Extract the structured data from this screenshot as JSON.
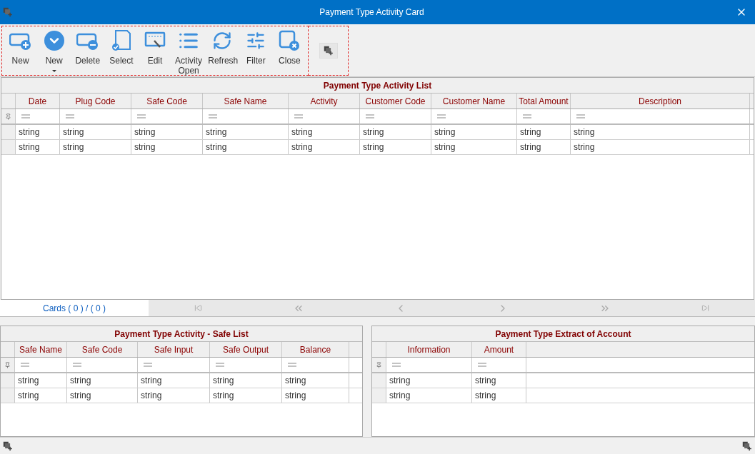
{
  "window": {
    "title": "Payment Type Activity Card"
  },
  "toolbar": {
    "buttons": [
      {
        "label": "New",
        "kind": "new"
      },
      {
        "label": "New",
        "kind": "dropdown"
      },
      {
        "label": "Delete",
        "kind": "delete"
      },
      {
        "label": "Select",
        "kind": "select"
      },
      {
        "label": "Edit",
        "kind": "edit"
      },
      {
        "label": "Activity Open",
        "kind": "list"
      },
      {
        "label": "Refresh",
        "kind": "refresh"
      },
      {
        "label": "Filter",
        "kind": "filter"
      },
      {
        "label": "Close",
        "kind": "close"
      }
    ]
  },
  "activity_list": {
    "title": "Payment Type Activity List",
    "columns": [
      "Date",
      "Plug Code",
      "Safe Code",
      "Safe Name",
      "Activity",
      "Customer Code",
      "Customer Name",
      "Total Amount",
      "Description"
    ],
    "rows": [
      [
        "string",
        "string",
        "string",
        "string",
        "string",
        "string",
        "string",
        "string",
        "string"
      ],
      [
        "string",
        "string",
        "string",
        "string",
        "string",
        "string",
        "string",
        "string",
        "string"
      ]
    ]
  },
  "pager": {
    "label": "Cards ( 0 ) / ( 0 )"
  },
  "safe_list": {
    "title": "Payment Type Activity - Safe List",
    "columns": [
      "Safe Name",
      "Safe Code",
      "Safe Input",
      "Safe Output",
      "Balance"
    ],
    "rows": [
      [
        "string",
        "string",
        "string",
        "string",
        "string"
      ],
      [
        "string",
        "string",
        "string",
        "string",
        "string"
      ]
    ]
  },
  "extract": {
    "title": "Payment Type Extract of Account",
    "columns": [
      "Information",
      "Amount"
    ],
    "rows": [
      [
        "string",
        "string"
      ],
      [
        "string",
        "string"
      ]
    ]
  }
}
